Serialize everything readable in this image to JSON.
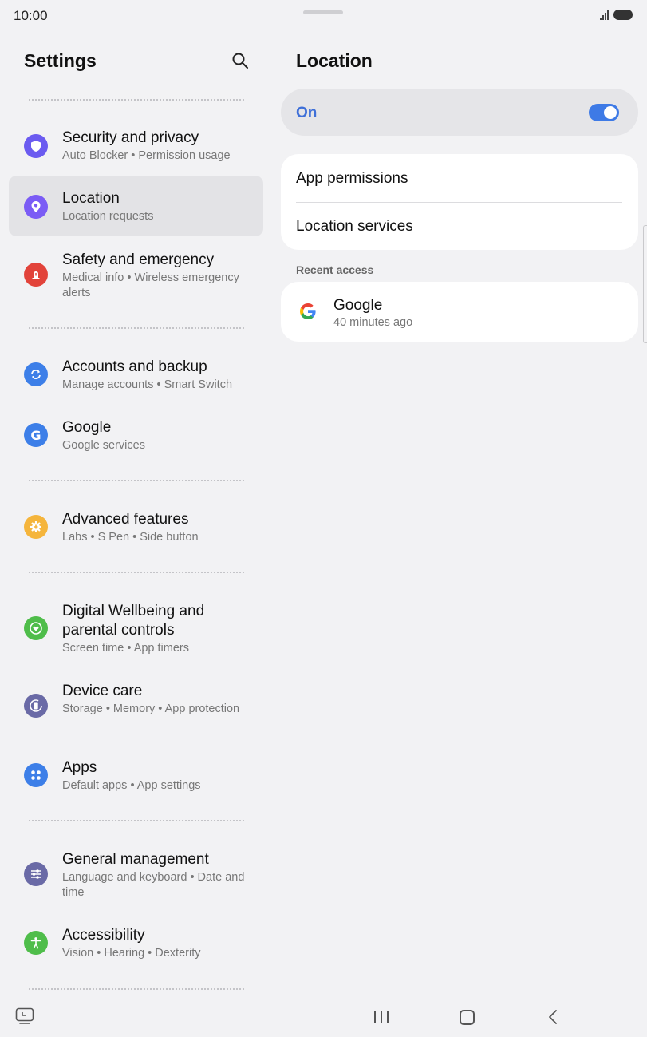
{
  "status_bar": {
    "time": "10:00"
  },
  "left_panel": {
    "title": "Settings",
    "items": [
      {
        "title": "Security and privacy",
        "subtitle": "Auto Blocker  •  Permission usage",
        "icon": "shield-icon",
        "color": "#6b5bf0"
      },
      {
        "title": "Location",
        "subtitle": "Location requests",
        "icon": "location-pin-icon",
        "color": "#7b5cf5",
        "selected": true
      },
      {
        "title": "Safety and emergency",
        "subtitle": "Medical info  •  Wireless emergency alerts",
        "icon": "alert-icon",
        "color": "#e2433a"
      },
      {
        "title": "Accounts and backup",
        "subtitle": "Manage accounts  •  Smart Switch",
        "icon": "sync-icon",
        "color": "#3d7fe8"
      },
      {
        "title": "Google",
        "subtitle": "Google services",
        "icon": "google-g-icon",
        "color": "#3d7fe8"
      },
      {
        "title": "Advanced features",
        "subtitle": "Labs  •  S Pen  •  Side button",
        "icon": "gear-plus-icon",
        "color": "#f5b53c"
      },
      {
        "title": "Digital Wellbeing and parental controls",
        "subtitle": "Screen time  •  App timers",
        "icon": "heart-ring-icon",
        "color": "#4fbd4a"
      },
      {
        "title": "Device care",
        "subtitle": "Storage  •  Memory  •  App protection",
        "icon": "device-care-icon",
        "color": "#6a6aa6"
      },
      {
        "title": "Apps",
        "subtitle": "Default apps  •  App settings",
        "icon": "apps-grid-icon",
        "color": "#3d7fe8"
      },
      {
        "title": "General management",
        "subtitle": "Language and keyboard  •  Date and time",
        "icon": "sliders-icon",
        "color": "#6a6aa6"
      },
      {
        "title": "Accessibility",
        "subtitle": "Vision  •  Hearing  •  Dexterity",
        "icon": "accessibility-icon",
        "color": "#4fbd4a"
      }
    ]
  },
  "right_panel": {
    "title": "Location",
    "toggle_label": "On",
    "toggle_on": true,
    "menu": [
      "App permissions",
      "Location services"
    ],
    "recent_header": "Recent access",
    "recent": [
      {
        "name": "Google",
        "time": "40 minutes ago",
        "icon": "google-logo-icon"
      }
    ]
  }
}
